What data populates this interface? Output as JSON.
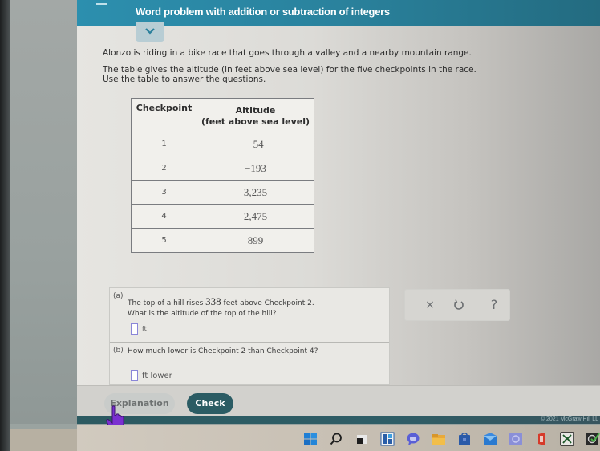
{
  "header": {
    "title": "Word problem with addition or subtraction of integers",
    "menu_icon": "hamburger-menu-icon",
    "collapse_icon": "chevron-down-icon"
  },
  "intro": {
    "line1": "Alonzo is riding in a bike race that goes through a valley and a nearby mountain range.",
    "line2": "The table gives the altitude (in feet above sea level) for the five checkpoints in the race.",
    "line3": "Use the table to answer the questions."
  },
  "table": {
    "headers": {
      "checkpoint": "Checkpoint",
      "altitude_line1": "Altitude",
      "altitude_line2": "(feet above sea level)"
    },
    "rows": [
      {
        "checkpoint": "1",
        "altitude": "−54"
      },
      {
        "checkpoint": "2",
        "altitude": "−193"
      },
      {
        "checkpoint": "3",
        "altitude": "3,235"
      },
      {
        "checkpoint": "4",
        "altitude": "2,475"
      },
      {
        "checkpoint": "5",
        "altitude": "899"
      }
    ]
  },
  "questions": {
    "a": {
      "label": "(a)",
      "text_before": "The top of a hill rises ",
      "number": "338",
      "text_after": " feet above Checkpoint 2.",
      "line2": "What is the altitude of the top of the hill?",
      "answer_value": "",
      "unit": "ft"
    },
    "b": {
      "label": "(b)",
      "text": "How much lower is Checkpoint 2 than Checkpoint 4?",
      "answer_value": "",
      "unit": "ft lower"
    }
  },
  "actions": {
    "close": "×",
    "undo": "↻",
    "help": "?"
  },
  "buttons": {
    "explanation": "Explanation",
    "check": "Check"
  },
  "footer": {
    "copyright": "© 2021 McGraw Hill LL"
  },
  "colors": {
    "header": "#2a829d",
    "check_button": "#2b5c64",
    "answer_box_border": "#8a86d8",
    "cursor": "#7a2fd0"
  },
  "taskbar": {
    "icons": [
      "windows-start-icon",
      "search-icon",
      "task-view-icon",
      "widgets-icon",
      "chat-icon",
      "file-explorer-icon",
      "store-icon",
      "mail-icon",
      "app-icon",
      "office-icon",
      "xbox-icon",
      "app-check-icon"
    ]
  }
}
